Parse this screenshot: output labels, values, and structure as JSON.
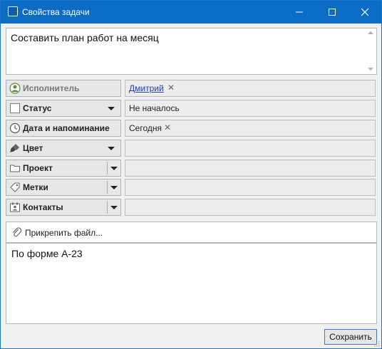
{
  "window": {
    "title": "Свойства задачи",
    "accent": "#0b6cc6"
  },
  "subject": {
    "value": "Составить план работ на месяц"
  },
  "fields": [
    {
      "label": "Исполнитель",
      "value": "Дмитрий",
      "icon": "person-icon",
      "dropdown": "none"
    },
    {
      "label": "Статус",
      "value": "Не началось",
      "icon": "checkbox-icon",
      "dropdown": "arrow"
    },
    {
      "label": "Дата и напоминание",
      "value": "Сегодня",
      "icon": "clock-icon",
      "dropdown": "none"
    },
    {
      "label": "Цвет",
      "value": "",
      "icon": "paint-brush-icon",
      "dropdown": "arrow"
    },
    {
      "label": "Проект",
      "value": "",
      "icon": "folder-icon",
      "dropdown": "split"
    },
    {
      "label": "Метки",
      "value": "",
      "icon": "tag-icon",
      "dropdown": "split"
    },
    {
      "label": "Контакты",
      "value": "",
      "icon": "contacts-icon",
      "dropdown": "split"
    }
  ],
  "attach": {
    "label": "Прикрепить файл..."
  },
  "notes": {
    "value": "По форме А-23"
  },
  "footer": {
    "save_label": "Сохранить"
  }
}
